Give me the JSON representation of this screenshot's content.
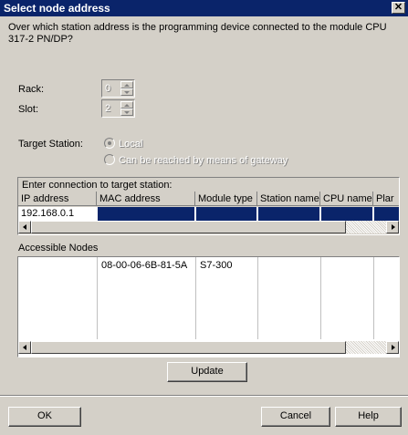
{
  "dialog": {
    "title": "Select node address",
    "close_glyph": "✕",
    "question": "Over which station address is the programming device connected to the module CPU 317-2 PN/DP?"
  },
  "fields": {
    "rack_label": "Rack:",
    "rack_value": "0",
    "slot_label": "Slot:",
    "slot_value": "2",
    "target_station_label": "Target Station:",
    "option_local": "Local",
    "option_gateway": "Can be reached by means of gateway"
  },
  "connection_table": {
    "title": "Enter connection to target station:",
    "columns": [
      "IP address",
      "MAC address",
      "Module type",
      "Station name",
      "CPU name",
      "Plar"
    ],
    "rows": [
      [
        "192.168.0.1",
        "",
        "",
        "",
        "",
        ""
      ]
    ]
  },
  "accessible_nodes": {
    "label": "Accessible Nodes",
    "rows": [
      [
        "",
        "08-00-06-6B-81-5A",
        "S7-300",
        "",
        "",
        ""
      ]
    ]
  },
  "buttons": {
    "update": "Update",
    "ok": "OK",
    "cancel": "Cancel",
    "help": "Help"
  },
  "colors": {
    "titlebar": "#0a246a",
    "selection": "#0a246a"
  }
}
